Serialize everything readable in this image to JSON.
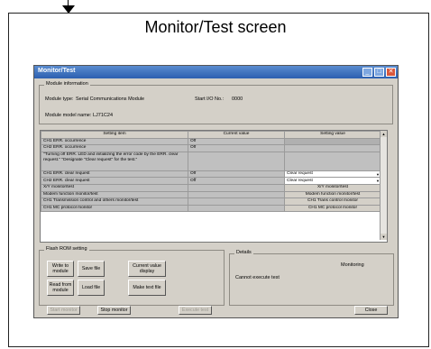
{
  "caption": "Monitor/Test screen",
  "window": {
    "title": "Monitor/Test"
  },
  "module_info": {
    "group_label": "Module information",
    "type_label": "Module type:",
    "type_value": "Serial Communications Module",
    "io_label": "Start I/O No.:",
    "io_value": "0000",
    "model_label": "Module model name:",
    "model_value": "LJ71C24"
  },
  "grid": {
    "headers": [
      "Setting item",
      "Current value",
      "Setting value"
    ],
    "rows": [
      {
        "item": "CH1 ERR. occurrence",
        "current": "Off",
        "setting": ""
      },
      {
        "item": "CH2 ERR. occurrence",
        "current": "Off",
        "setting": ""
      },
      {
        "item": "\"Turning off ERR. LED and initializing the error code by the ERR. clear request.\" \"Designate \"Clear request\" for the test.\"",
        "current": "",
        "setting": ""
      },
      {
        "item": "CH1 ERR. clear request",
        "current": "Off",
        "setting": "Clear request"
      },
      {
        "item": "CH2 ERR. clear request",
        "current": "Off",
        "setting": "Clear request"
      },
      {
        "item": "X/Y monitor/test",
        "current": "",
        "setting": "X/Y monitor/test"
      },
      {
        "item": "Modem function monitor/test",
        "current": "",
        "setting": "Modem function monitor/test"
      },
      {
        "item": "CH1 Transmission control and others monitor/test",
        "current": "",
        "setting": "CH1 Trans control monitor"
      },
      {
        "item": "CH1 MC protocol monitor",
        "current": "",
        "setting": "CH1 MC protocol monitor"
      }
    ]
  },
  "flash": {
    "group_label": "Flash ROM setting",
    "write_label": "Write to module",
    "save_label": "Save file",
    "read_label": "Read from module",
    "load_label": "Load file",
    "current_label": "Current value display",
    "text_label": "Make text file"
  },
  "details": {
    "group_label": "Details",
    "status": "Monitoring",
    "message": "Cannot execute test"
  },
  "footer": {
    "start_label": "Start monitor",
    "stop_label": "Stop monitor",
    "execute_label": "Execute test",
    "close_label": "Close"
  }
}
